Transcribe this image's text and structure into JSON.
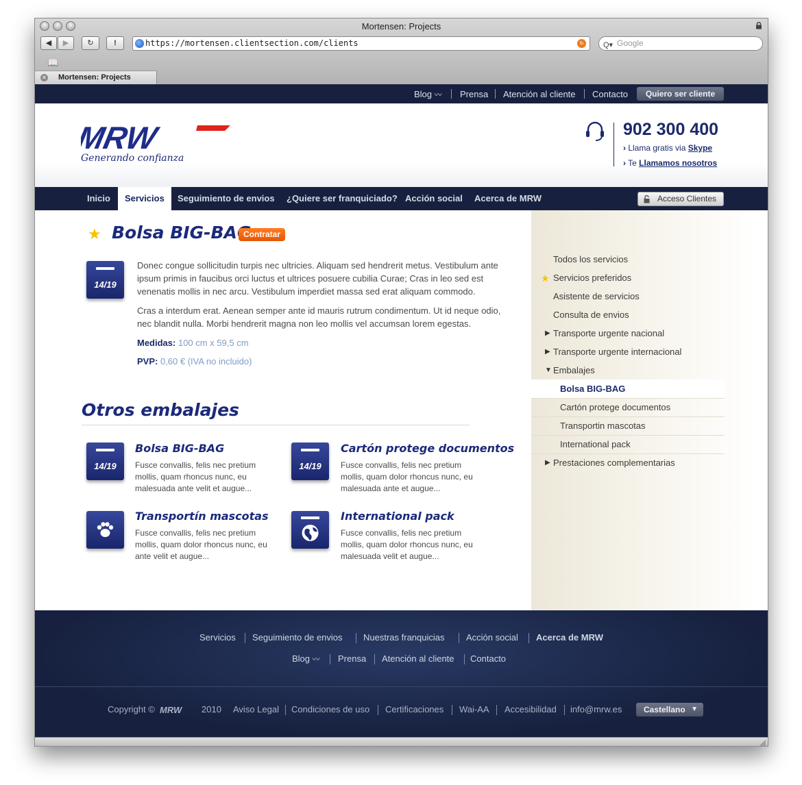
{
  "window": {
    "title": "Mortensen: Projects"
  },
  "browser": {
    "url": "https://mortensen.clientsection.com/clients",
    "search_placeholder": "Google",
    "tab_label": "Mortensen: Projects"
  },
  "topbar": {
    "links": [
      "Blog",
      "Prensa",
      "Atención al cliente",
      "Contacto"
    ],
    "cta": "Quiero ser cliente"
  },
  "header": {
    "logo_text": "MRW",
    "tagline": "Generando confianza",
    "phone": "902 300 400",
    "call_free_prefix": "Llama gratis via",
    "call_free_link": "Skype",
    "call_back_prefix": "Te",
    "call_back_link": "Llamamos nosotros"
  },
  "nav": {
    "items": [
      "Inicio",
      "Servicios",
      "Seguimiento de envios",
      "¿Quiere ser franquiciado?",
      "Acción social",
      "Acerca de MRW"
    ],
    "active": "Servicios",
    "access_button": "Acceso Clientes"
  },
  "product": {
    "title": "Bolsa BIG-BAG",
    "badge": "Contratar",
    "icon_number": "14/19",
    "paragraph_1": "Donec congue sollicitudin turpis nec ultricies. Aliquam sed hendrerit metus. Vestibulum ante ipsum primis in faucibus orci luctus et ultrices posuere cubilia Curae; Cras in leo sed est venenatis mollis in nec arcu. Vestibulum imperdiet massa sed erat aliquam commodo.",
    "paragraph_2": "Cras a interdum erat. Aenean semper ante id mauris rutrum condimentum. Ut id neque odio, nec blandit nulla. Morbi hendrerit magna non leo mollis vel accumsan lorem egestas.",
    "medidas_label": "Medidas:",
    "medidas_value": "100 cm x 59,5 cm",
    "pvp_label": "PVP:",
    "pvp_value": "0,60 € (IVA no incluido)"
  },
  "otros": {
    "title": "Otros embalajes",
    "items": [
      {
        "title": "Bolsa BIG-BAG",
        "icon": "calendar-icon",
        "icon_number": "14/19",
        "text": "Fusce convallis, felis nec pretium mollis, quam rhoncus nunc, eu malesuada ante velit et augue..."
      },
      {
        "title": "Cartón protege documentos",
        "icon": "calendar-icon",
        "icon_number": "14/19",
        "text": "Fusce convallis, felis nec pretium mollis, quam dolor rhoncus nunc, eu malesuada ante et augue..."
      },
      {
        "title": "Transportín mascotas",
        "icon": "paw-icon",
        "text": "Fusce convallis, felis nec pretium mollis, quam dolor rhoncus nunc, eu  ante velit et augue..."
      },
      {
        "title": "International pack",
        "icon": "globe-icon",
        "text": "Fusce convallis, felis nec pretium mollis, quam dolor rhoncus nunc, eu malesuada velit et augue..."
      }
    ]
  },
  "sidebar": {
    "items": [
      "Todos los servicios",
      "Servicios preferidos",
      "Asistente de servicios",
      "Consulta de envios",
      "Transporte urgente nacional",
      "Transporte urgente internacional",
      "Embalajes"
    ],
    "subitems": [
      "Bolsa BIG-BAG",
      "Cartón protege documentos",
      "Transportin mascotas",
      "International pack"
    ],
    "active_subitem": "Bolsa BIG-BAG",
    "last_item": "Prestaciones complementarias"
  },
  "footer": {
    "row1": [
      "Servicios",
      "Seguimiento de envios",
      "Nuestras franquicias",
      "Acción social",
      "Acerca de MRW"
    ],
    "row2": [
      "Blog",
      "Prensa",
      "Atención al cliente",
      "Contacto"
    ],
    "copyright_prefix": "Copyright ©",
    "logo_text": "MRW",
    "year": "2010",
    "legal": [
      "Aviso Legal",
      "Condiciones de uso",
      "Certificaciones",
      "Wai-AA",
      "Accesibilidad",
      "info@mrw.es"
    ],
    "language": "Castellano"
  },
  "colors": {
    "navy": "#17213f",
    "brand_blue": "#1b2a7a",
    "orange": "#ff6a00",
    "star": "#f5c400"
  }
}
